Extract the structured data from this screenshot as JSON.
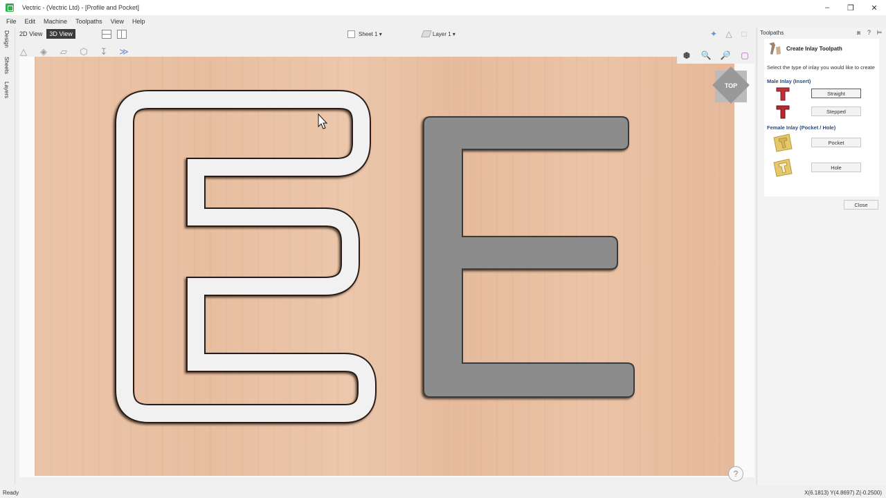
{
  "window": {
    "title": "Vectric - (Vectric Ltd) - [Profile and Pocket]",
    "controls": [
      "minimize",
      "restore",
      "close"
    ]
  },
  "menu": [
    "File",
    "Edit",
    "Machine",
    "Toolpaths",
    "View",
    "Help"
  ],
  "left_tabs": [
    "Design",
    "Sheets",
    "Layers"
  ],
  "view_tabs": {
    "tab2d": "2D View",
    "tab3d": "3D View",
    "active": "3D View"
  },
  "sheet_selector": "Sheet 1 ▾",
  "layer_selector": "Layer 1 ▾",
  "viewport": {
    "orientation_cube_label": "TOP",
    "help_label": "?"
  },
  "panel": {
    "header": "Toolpaths",
    "title": "Create Inlay Toolpath",
    "description": "Select the type of inlay you would like to create",
    "male_section": "Male Inlay (Insert)",
    "female_section": "Female Inlay (Pocket / Hole)",
    "buttons": {
      "straight": "Straight",
      "stepped": "Stepped",
      "pocket": "Pocket",
      "hole": "Hole",
      "close": "Close"
    }
  },
  "status": {
    "left": "Ready",
    "coords": "X(6.1813) Y(4.8697) Z(-0.2500)"
  },
  "colors": {
    "wood": "#e9c2a5",
    "pocket_fill": "#8c8c8c",
    "profile_groove": "#f1f1f1",
    "male_icon": "#c0303a",
    "female_icon": "#e5c86a"
  }
}
